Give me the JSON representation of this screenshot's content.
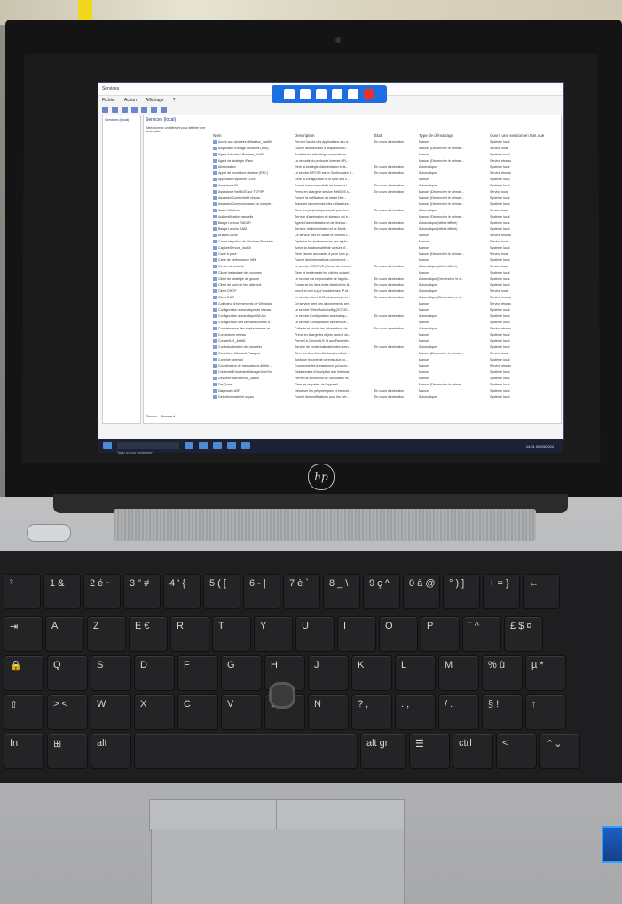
{
  "window": {
    "title": "Services",
    "menu": [
      "Fichier",
      "Action",
      "Affichage",
      "?"
    ],
    "tree_root": "Services (local)",
    "pane_header": "Services (local)",
    "left_description": "Sélectionnez un élément pour afficher une description."
  },
  "columns": [
    "Nom",
    "Description",
    "État",
    "Type de démarrage",
    "Ouvrir une session en tant que"
  ],
  "rows": [
    [
      "Accès aux données utilisateur_4ad65",
      "Permet l'accès des applications aux d...",
      "En cours d'exécution",
      "Manuel",
      "Système local"
    ],
    [
      "Acquisition d'image Windows (WIA)",
      "Fournit des services d'acquisition d'i...",
      "",
      "Manuel (Déclencher le démarr...",
      "Service local"
    ],
    [
      "Agent Activation Runtime_4ad65",
      "Runtime for activating conversationa...",
      "",
      "Manuel",
      "Système local"
    ],
    [
      "Agent de stratégie IPsec",
      "La sécurité du protocole Internet (IP)...",
      "",
      "Manuel (Déclencher le démarr...",
      "Service réseau"
    ],
    [
      "Alimentation",
      "Gère la stratégie d'alimentation et la...",
      "En cours d'exécution",
      "Automatique",
      "Système local"
    ],
    [
      "Appel de procédure distante (RPC)",
      "Le service RPCSS est le Gestionnaire d...",
      "En cours d'exécution",
      "Automatique",
      "Service réseau"
    ],
    [
      "Application système COM+",
      "Gère la configuration et le suivi des c...",
      "",
      "Manuel",
      "Système local"
    ],
    [
      "Assistance IP",
      "Fournit une connectivité de tunnel à l...",
      "En cours d'exécution",
      "Automatique",
      "Système local"
    ],
    [
      "Assistance NetBIOS sur TCP/IP",
      "Prend en charge le service NetBIOS s...",
      "En cours d'exécution",
      "Manuel (Déclencher le démarr...",
      "Service local"
    ],
    [
      "Assistant Connectivité réseau",
      "Fournit la notification du statut Dire...",
      "",
      "Manuel (Déclencher le démarr...",
      "Système local"
    ],
    [
      "Assistant Connexion avec un compte...",
      "Autoriser la connexion des utilisateurs...",
      "",
      "Manuel (Déclencher le démarr...",
      "Système local"
    ],
    [
      "Audio Windows",
      "Gère les périphériques audio pour les...",
      "En cours d'exécution",
      "Automatique",
      "Service local"
    ],
    [
      "Authentification naturelle",
      "Service d'agrégation de signaux qui é...",
      "",
      "Manuel (Déclencher le démarr...",
      "Système local"
    ],
    [
      "Badge Lenovo RADAR",
      "Agent d'administration et de Monitor...",
      "En cours d'exécution",
      "Automatique (début différé)",
      "Système local"
    ],
    [
      "Badge Lenovo SAM",
      "Serveur d'administration et de Monit...",
      "En cours d'exécution",
      "Automatique (début différé)",
      "Système local"
    ],
    [
      "BranchCache",
      "Ce service met en cache le contenu r...",
      "",
      "Manuel",
      "Service réseau"
    ],
    [
      "Cache de police de Windows Presenta...",
      "Optimise les performances des applic...",
      "",
      "Manuel",
      "Service local"
    ],
    [
      "CaptureService_4ad65",
      "Active la fonctionnalité de capture d'...",
      "",
      "Manuel",
      "Système local"
    ],
    [
      "Carte à puce",
      "Gère l'accès aux cartes à puce lues p...",
      "",
      "Manuel (Déclencher le démarr...",
      "Service local"
    ],
    [
      "Carte de performance WMI",
      "Fournit des informations concernant ...",
      "",
      "Manuel",
      "Système local"
    ],
    [
      "Centre de sécurité",
      "Le service WSCSVC (Centre de sécurit...",
      "En cours d'exécution",
      "Automatique (début différé)",
      "Service local"
    ],
    [
      "Cliché instantané des volumes",
      "Gère et implémente les clichés instant...",
      "",
      "Manuel",
      "Système local"
    ],
    [
      "Client de stratégie de groupe",
      "Le service est responsable de l'applic...",
      "En cours d'exécution",
      "Automatique (Déclencher le d...",
      "Système local"
    ],
    [
      "Client de suivi de lien distribué",
      "Conserve les liens entre des fichiers N...",
      "En cours d'exécution",
      "Automatique",
      "Système local"
    ],
    [
      "Client DHCP",
      "Inscrit et met à jour les adresses IP et...",
      "En cours d'exécution",
      "Automatique",
      "Service local"
    ],
    [
      "Client DNS",
      "Le service client DNS (dnscache) met ...",
      "En cours d'exécution",
      "Automatique (Déclencher le d...",
      "Service réseau"
    ],
    [
      "Collecteur d'événements de Windows",
      "Ce service gère des abonnements per...",
      "",
      "Manuel",
      "Service réseau"
    ],
    [
      "Configuration automatique de réseau...",
      "Le service Wired AutoConfig (DOT3S...",
      "",
      "Manuel",
      "Système local"
    ],
    [
      "Configuration automatique WLAN",
      "Le service Configuration automatiqu...",
      "En cours d'exécution",
      "Automatique",
      "Système local"
    ],
    [
      "Configuration des services Bureau à ...",
      "Le service Configuration des service...",
      "",
      "Manuel",
      "Système local"
    ],
    [
      "Connaissance des emplacements ré...",
      "Collecte et stocke les informations de...",
      "En cours d'exécution",
      "Automatique",
      "Service réseau"
    ],
    [
      "Connexions réseau",
      "Prend en charge les objets dans le do...",
      "",
      "Manuel",
      "Système local"
    ],
    [
      "ConsentUX_4ad65",
      "Permet à ConnectUX et aux Paramètr...",
      "",
      "Manuel",
      "Système local"
    ],
    [
      "Contextualisation des données",
      "Service de contextualisation des donn...",
      "En cours d'exécution",
      "Automatique",
      "Système local"
    ],
    [
      "Contrôleur Microsoft Passport",
      "Gère les clés d'identité locales utilisé...",
      "",
      "Manuel (Déclencher le démarr...",
      "Service local"
    ],
    [
      "Contrôle parental",
      "Applique le contrôle parental aux co...",
      "",
      "Manuel",
      "Système local"
    ],
    [
      "Coordinateur de transactions distrib...",
      "Coordonne les transactions qui couvr...",
      "",
      "Manuel",
      "Service réseau"
    ],
    [
      "CredentialEnrollmentManagerUserSvc",
      "Gestionnaire d'inscription des informat...",
      "",
      "Manuel",
      "Système local"
    ],
    [
      "DevicesFlowUserSvc_4ad65",
      "Permet la connexion de l'ordinateur et...",
      "",
      "Manuel",
      "Système local"
    ],
    [
      "DevQuery",
      "Gère les requêtes de l'appareil...",
      "",
      "Manuel (Déclencher le démarr...",
      "Système local"
    ],
    [
      "Diagnostic ASR",
      "Découvre les périphériques et exécute ...",
      "En cours d'exécution",
      "Manuel",
      "Système local"
    ],
    [
      "Détection matériel noyau",
      "Fournit des notifications pour les évé...",
      "En cours d'exécution",
      "Automatique",
      "Système local"
    ]
  ],
  "tabs": [
    "Étendu",
    "Standard"
  ],
  "taskbar": {
    "search_placeholder": "Taper ici pour rechercher",
    "time": "14:01",
    "date": "05/03/2024"
  },
  "laptop": {
    "brand": "hp"
  },
  "keyboard_rows": [
    [
      "²",
      "1 &",
      "2 é ~",
      "3 \" #",
      "4 ' {",
      "5 ( [",
      "6 - |",
      "7 è `",
      "8 _ \\",
      "9 ç ^",
      "0 à @",
      "° ) ]",
      "+ = }",
      "←"
    ],
    [
      "⇥",
      "A",
      "Z",
      "E €",
      "R",
      "T",
      "Y",
      "U",
      "I",
      "O",
      "P",
      "¨ ^",
      "£ $ ¤"
    ],
    [
      "🔒",
      "Q",
      "S",
      "D",
      "F",
      "G",
      "H",
      "J",
      "K",
      "L",
      "M",
      "% ù",
      "µ *"
    ],
    [
      "⇧",
      "> <",
      "W",
      "X",
      "C",
      "V",
      "B",
      "N",
      "? ,",
      ". ;",
      "/ :",
      "§ !",
      "↑"
    ],
    [
      "fn",
      "⊞",
      "alt",
      "",
      "alt gr",
      "☰",
      "ctrl",
      "<",
      "⌃⌄"
    ]
  ],
  "colors": {
    "remote_bar": "#1b6fe0",
    "close_button": "#e8322d",
    "taskbar": "#1c2233",
    "chassis": "#b5b6b8",
    "keys": "#242426"
  }
}
